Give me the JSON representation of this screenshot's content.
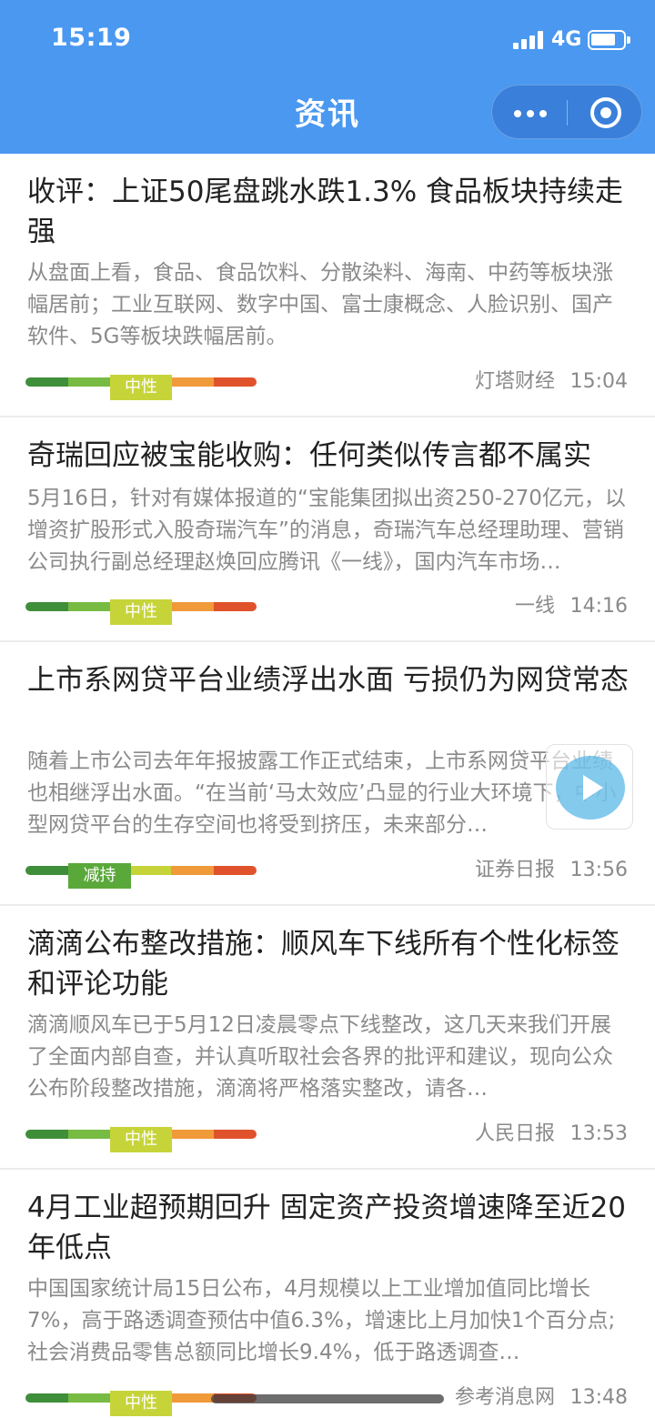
{
  "status_bar": {
    "time": "15:19",
    "network": "4G"
  },
  "nav": {
    "title": "资讯"
  },
  "colors": {
    "header_bg": "#4a98f0",
    "gauge": [
      "#3f8f3a",
      "#77bb43",
      "#c6d43a",
      "#f09a3a",
      "#e0522b"
    ]
  },
  "news": [
    {
      "title": "收评：上证50尾盘跳水跌1.3% 食品板块持续走强",
      "summary": "从盘面上看，食品、食品饮料、分散染料、海南、中药等板块涨幅居前；工业互联网、数字中国、富士康概念、人脸识别、国产软件、5G等板块跌幅居前。",
      "sentiment": "中性",
      "source": "灯塔财经",
      "time": "15:04"
    },
    {
      "title": "奇瑞回应被宝能收购：任何类似传言都不属实",
      "summary": "5月16日，针对有媒体报道的“宝能集团拟出资250-270亿元，以增资扩股形式入股奇瑞汽车”的消息，奇瑞汽车总经理助理、营销公司执行副总经理赵焕回应腾讯《一线》，国内汽车市场…",
      "sentiment": "中性",
      "source": "一线",
      "time": "14:16"
    },
    {
      "title": "上市系网贷平台业绩浮出水面 亏损仍为网贷常态",
      "summary": "随着上市公司去年年报披露工作正式结束，上市系网贷平台业绩也相继浮出水面。“在当前‘马太效应’凸显的行业大环境下，中小型网贷平台的生存空间也将受到挤压，未来部分…",
      "sentiment": "减持",
      "source": "证券日报",
      "time": "13:56"
    },
    {
      "title": "滴滴公布整改措施：顺风车下线所有个性化标签和评论功能",
      "summary": "滴滴顺风车已于5月12日凌晨零点下线整改，这几天来我们开展了全面内部自查，并认真听取社会各界的批评和建议，现向公众公布阶段整改措施，滴滴将严格落实整改，请各…",
      "sentiment": "中性",
      "source": "人民日报",
      "time": "13:53"
    },
    {
      "title": "4月工业超预期回升 固定资产投资增速降至近20年低点",
      "summary": "中国国家统计局15日公布，4月规模以上工业增加值同比增长7%，高于路透调查预估中值6.3%，增速比上月加快1个百分点;社会消费品零售总额同比增长9.4%，低于路透调查…",
      "sentiment": "中性",
      "source": "参考消息网",
      "time": "13:48"
    }
  ]
}
